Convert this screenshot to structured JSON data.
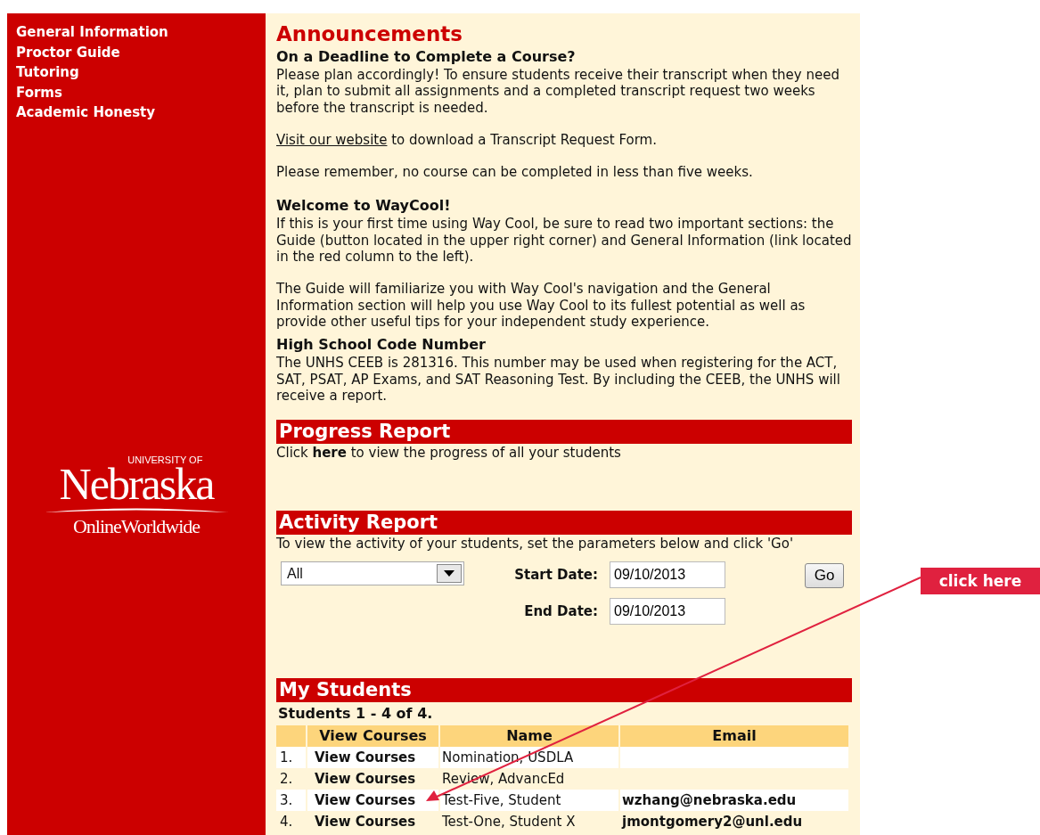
{
  "sidebar": {
    "items": [
      "General Information",
      "Proctor Guide",
      "Tutoring",
      "Forms",
      "Academic Honesty"
    ],
    "logo": {
      "top": "UNIVERSITY OF",
      "name": "Nebraska",
      "bottom": "OnlineWorldwide"
    }
  },
  "announcements": {
    "title": "Announcements",
    "sections": [
      {
        "heading": "On a Deadline to Complete a Course?",
        "paragraphs": [
          {
            "text": "Please plan accordingly! To ensure students receive their transcript when they need it, plan to submit all assignments and a completed transcript request two weeks before the transcript is needed."
          },
          {
            "link": "Visit our website",
            "text": " to download a Transcript Request Form."
          },
          {
            "text": "Please remember, no course can be completed in less than five weeks."
          }
        ]
      },
      {
        "heading": "Welcome to WayCool!",
        "paragraphs": [
          {
            "text": "If this is your first time using Way Cool, be sure to read two important sections: the Guide (button located in the upper right corner) and General Information (link located in the red column to the left)."
          },
          {
            "text": "The Guide will familiarize you with Way Cool's navigation and the General Information section will help you use Way Cool to its fullest potential as well as provide other useful tips for your independent study experience."
          }
        ]
      },
      {
        "heading": "High School Code Number",
        "paragraphs": [
          {
            "text": "The UNHS CEEB is 281316. This number may be used when registering for the ACT, SAT, PSAT, AP Exams, and SAT Reasoning Test. By including the CEEB, the UNHS will receive a report."
          }
        ]
      }
    ]
  },
  "progress_report": {
    "title": "Progress Report",
    "text": "Click **here** to view the progress of all your students"
  },
  "activity_report": {
    "title": "Activity Report",
    "instructions": "To view the activity of your students, set the parameters below and click 'Go'",
    "filter": {
      "value": "All"
    },
    "start_date": {
      "label": "Start Date:",
      "value": "09/10/2013"
    },
    "end_date": {
      "label": "End Date:",
      "value": "09/10/2013"
    },
    "go_button": "Go"
  },
  "my_students": {
    "title": "My Students",
    "summary": "Students 1 - 4 of 4.",
    "columns": [
      "View Courses",
      "Name",
      "Email"
    ],
    "rows": [
      {
        "number": "1.",
        "link": "View Courses",
        "name": "Nomination, USDLA",
        "email": ""
      },
      {
        "number": "2.",
        "link": "View Courses",
        "name": "Review, AdvancEd",
        "email": ""
      },
      {
        "number": "3.",
        "link": "View Courses",
        "name": "Test-Five, Student",
        "email": "wzhang@nebraska.edu"
      },
      {
        "number": "4.",
        "link": "View Courses",
        "name": "Test-One, Student X",
        "email": "jmontgomery2@unl.edu"
      }
    ]
  },
  "callout": {
    "label": "click here"
  }
}
